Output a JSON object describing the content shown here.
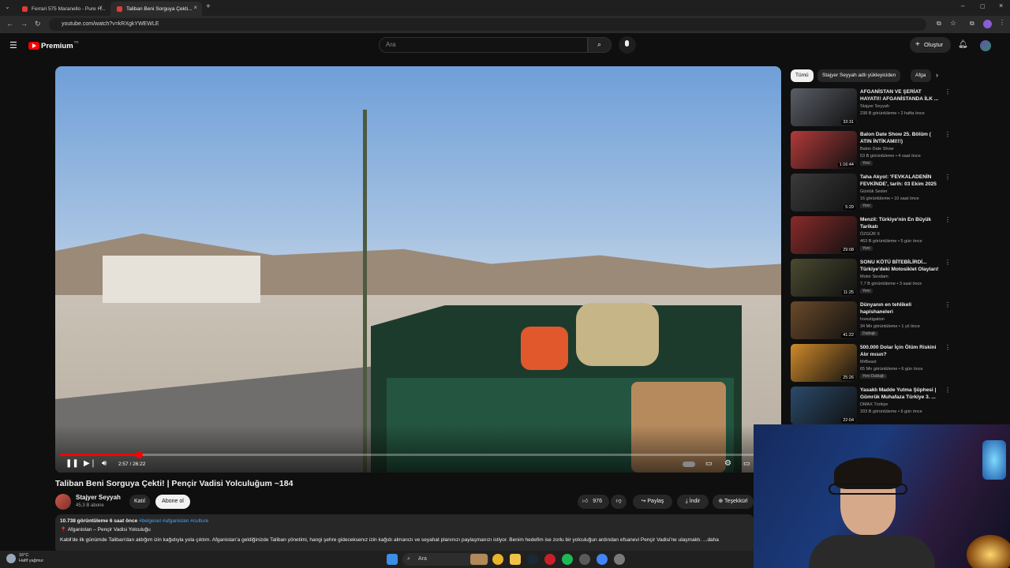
{
  "browser": {
    "tabs": [
      {
        "title": "Ferrari 575 Maranello - Pure H..."
      },
      {
        "title": "Taliban Beni Sorguya Çekti..."
      }
    ],
    "url": "youtube.com/watch?v=kRXgkYWEWLE"
  },
  "header": {
    "logo": "Premium",
    "logo_badge": "TR",
    "search_placeholder": "Ara",
    "create_label": "Oluştur"
  },
  "player": {
    "progress": 0.114,
    "time": "2:57 / 26:22"
  },
  "video": {
    "title": "Taliban Beni Sorguya Çekti! | Pençir Vadisi Yolculuğum ~184",
    "channel": "Stajyer Seyyah",
    "subscribers": "45,3 B abone",
    "join_label": "Katıl",
    "subscribe_label": "Abone ol",
    "likes": "976",
    "share_label": "Paylaş",
    "download_label": "İndir",
    "thanks_label": "Teşekkürl"
  },
  "description": {
    "views_age": "10.738 görüntüleme  6 saat önce",
    "tags": "#belgesel #afganistan #culture",
    "location": "Afganistan – Pençir Vadisi Yolculuğu",
    "text": "Kabil'de ilk günümde Taliban'dan aldığım izin kağıdıyla yola çıktım. Afganistan'a geldiğinizde Taliban yönetimi, hangi şehre gideceksenız izin kağıdı almanızı ve seyahat planınızı paylaşmanızı istiyor. Benim hedefim ise zorlu bir yolculuğun ardından efsanevi Pençir Vadisi'ne ulaşmaktı.  ...daha"
  },
  "chips": [
    "Tümü",
    "Stajyer Seyyah adlı yükleyiciden",
    "Afga"
  ],
  "recommendations": [
    {
      "title": "AFGANİSTAN VE ŞERİAT HAYATI!! AFGANİSTANDA İLK ...",
      "channel": "Stajyer Seyyah",
      "meta": "238 B görüntüleme • 2 hafta önce",
      "badge": "",
      "duration": "33:31",
      "thumb_color": "#5a5e66"
    },
    {
      "title": "Balon Date Show 25. Bölüm ( ATIN İNTİKAMI!!!)",
      "channel": "Balon Date Show",
      "meta": "53 B görüntüleme • 4 saat önce",
      "badge": "Yeni",
      "duration": "1:16:44",
      "thumb_color": "#b33a3a"
    },
    {
      "title": "Taha Akyol: 'FEVKALADENİN FEVKİNDE', tarih: 03 Ekim 2025",
      "channel": "Günlük Sesler",
      "meta": "16 görüntüleme • 10 saat önce",
      "badge": "Yeni",
      "duration": "5:29",
      "thumb_color": "#3a3a3a"
    },
    {
      "title": "Menzil: Türkiye'nin En Büyük Tarikatı",
      "channel": "ÖZGÜR X",
      "meta": "463 B görüntüleme • 5 gün önce",
      "badge": "Yeni",
      "duration": "29:08",
      "thumb_color": "#8a2a2a"
    },
    {
      "title": "SONU KÖTÜ BİTEBİLİRDİ... Türkiye'deki Motosiklet Olayları! ...",
      "channel": "Motor Sevdam",
      "meta": "7,7 B görüntüleme • 3 saat önce",
      "badge": "Yeni",
      "duration": "11:25",
      "thumb_color": "#4a4a30"
    },
    {
      "title": "Dünyanın en tehlikeli hapishaneleri",
      "channel": "Investigation",
      "meta": "34 Mn görüntüleme • 1 yıl önce",
      "badge": "Dublajlı",
      "duration": "41:22",
      "thumb_color": "#6b4a2a"
    },
    {
      "title": "500.000 Dolar İçin Ölüm Riskini Alır mısın?",
      "channel": "MrBeast",
      "meta": "65 Mn görüntüleme • 6 gün önce",
      "badge": "Yeni  Dublajlı",
      "duration": "25:26",
      "thumb_color": "#d08a2a"
    },
    {
      "title": "Yasaklı Madde Yutma Şüphesi | Gümrük Muhafaza Türkiye 3. ...",
      "channel": "DMAX Türkiye",
      "meta": "333 B görüntüleme • 6 gün önce",
      "badge": "",
      "duration": "22:04",
      "thumb_color": "#2a4a6a"
    }
  ],
  "taskbar": {
    "weather_temp": "16°C",
    "weather_text": "Hafif yağmur",
    "search_placeholder": "Ara"
  },
  "colors": {
    "accent": "#ff0000",
    "link": "#3ea6ff",
    "background": "#0f0f0f"
  }
}
